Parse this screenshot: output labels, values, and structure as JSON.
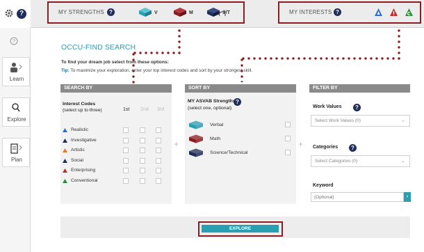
{
  "nav": {
    "help_badge": "?",
    "items": [
      {
        "label": "Learn",
        "icon": "learn-icon"
      },
      {
        "label": "Explore",
        "icon": "search-icon"
      },
      {
        "label": "Plan",
        "icon": "clipboard-icon"
      }
    ]
  },
  "topbar": {
    "strengths_title": "MY STRENGTHS",
    "strengths": [
      {
        "label": "V",
        "color": "#2a9fb1"
      },
      {
        "label": "M",
        "color": "#8b1d22"
      },
      {
        "label": "S/T",
        "color": "#1f2d58"
      }
    ],
    "interests_title": "MY INTERESTS",
    "interest_icons": [
      {
        "color": "#2a6fd1",
        "letter": "R"
      },
      {
        "color": "#c62828",
        "letter": "E"
      },
      {
        "color": "#2e8b3a",
        "letter": "C"
      }
    ],
    "help": "?"
  },
  "main": {
    "title": "OCCU-FIND SEARCH",
    "intro": "To find your dream job select from these options:",
    "tip_label": "Tip:",
    "tip_text": "To maximize your exploration, enter your top interest codes and sort by your strongest skill."
  },
  "search_by": {
    "header": "SEARCH BY",
    "interest_title": "Interest Codes",
    "interest_sub": "(select up to three)",
    "columns": [
      "1st",
      "2nd",
      "3rd"
    ],
    "codes": [
      {
        "name": "Realistic",
        "color": "#2a6fd1"
      },
      {
        "name": "Investigative",
        "color": "#1f2d58"
      },
      {
        "name": "Artistic",
        "color": "#e87722"
      },
      {
        "name": "Social",
        "color": "#1f2d58"
      },
      {
        "name": "Enterprising",
        "color": "#c62828"
      },
      {
        "name": "Conventional",
        "color": "#2e8b3a"
      }
    ]
  },
  "sort_by": {
    "header": "SORT BY",
    "title": "MY ASVAB Strengths",
    "sub": "(select one, optional)",
    "options": [
      {
        "name": "Verbal",
        "color": "#2a9fb1"
      },
      {
        "name": "Math",
        "color": "#8b1d22"
      },
      {
        "name": "Science/Technical",
        "color": "#1f2d58"
      }
    ]
  },
  "filter_by": {
    "header": "FILTER BY",
    "work_values_label": "Work Values",
    "work_values_value": "Select Work Values (0)",
    "categories_label": "Categories",
    "categories_value": "Select Categories (0)",
    "keyword_label": "Keyword",
    "keyword_placeholder": "(Optional)",
    "go": "›"
  },
  "explore_label": "EXPLORE",
  "colors": {
    "accent": "#2a9fb1",
    "highlight": "#8b1d22",
    "navy": "#1f2d58"
  }
}
